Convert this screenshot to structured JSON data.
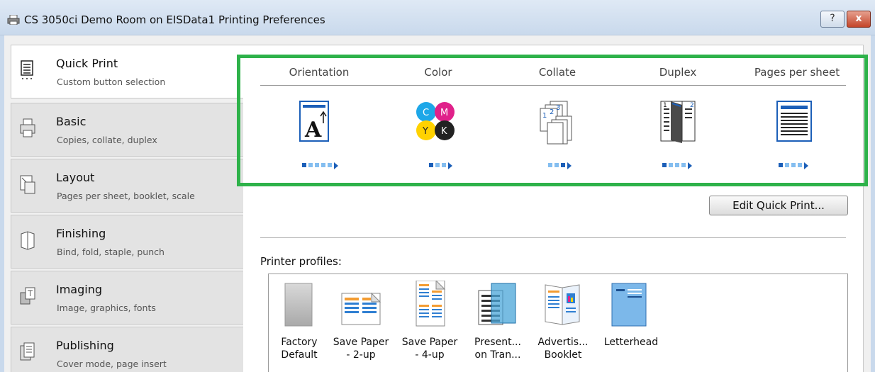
{
  "window": {
    "title": "CS 3050ci Demo Room on EISData1 Printing Preferences",
    "help_label": "?",
    "close_label": "x",
    "highlight_color": "#2eb24a"
  },
  "sidebar": {
    "items": [
      {
        "title": "Quick Print",
        "subtitle": "Custom button selection",
        "icon": "quick-print-icon",
        "active": true
      },
      {
        "title": "Basic",
        "subtitle": "Copies, collate, duplex",
        "icon": "basic-icon",
        "active": false
      },
      {
        "title": "Layout",
        "subtitle": "Pages per sheet, booklet, scale",
        "icon": "layout-icon",
        "active": false
      },
      {
        "title": "Finishing",
        "subtitle": "Bind, fold, staple, punch",
        "icon": "finishing-icon",
        "active": false
      },
      {
        "title": "Imaging",
        "subtitle": "Image, graphics, fonts",
        "icon": "imaging-icon",
        "active": false
      },
      {
        "title": "Publishing",
        "subtitle": "Cover mode, page insert",
        "icon": "publishing-icon",
        "active": false
      }
    ]
  },
  "quick_print": {
    "columns": [
      {
        "label": "Orientation",
        "icon": "orientation-icon",
        "options": 5,
        "selected": 1
      },
      {
        "label": "Color",
        "icon": "color-cmyk-icon",
        "options": 3,
        "selected": 1
      },
      {
        "label": "Collate",
        "icon": "collate-icon",
        "options": 3,
        "selected": 3
      },
      {
        "label": "Duplex",
        "icon": "duplex-icon",
        "options": 4,
        "selected": 1
      },
      {
        "label": "Pages per sheet",
        "icon": "pages-per-sheet-icon",
        "options": 4,
        "selected": 1
      }
    ],
    "color_icon_letters": [
      "C",
      "M",
      "Y",
      "K"
    ],
    "collate_icon_digits": [
      "1",
      "2",
      "3"
    ],
    "duplex_icon_digits": [
      "1",
      "2"
    ],
    "orientation_icon_letter": "A",
    "edit_button": "Edit Quick Print..."
  },
  "profiles": {
    "label": "Printer profiles:",
    "items": [
      {
        "label": "Factory\nDefault",
        "icon": "factory-default-icon"
      },
      {
        "label": "Save Paper\n- 2-up",
        "icon": "save-paper-2up-icon"
      },
      {
        "label": "Save Paper\n- 4-up",
        "icon": "save-paper-4up-icon"
      },
      {
        "label": "Present...\non Tran...",
        "icon": "presentation-transparency-icon"
      },
      {
        "label": "Advertis...\nBooklet",
        "icon": "advertising-booklet-icon"
      },
      {
        "label": "Letterhead",
        "icon": "letterhead-icon"
      }
    ]
  }
}
